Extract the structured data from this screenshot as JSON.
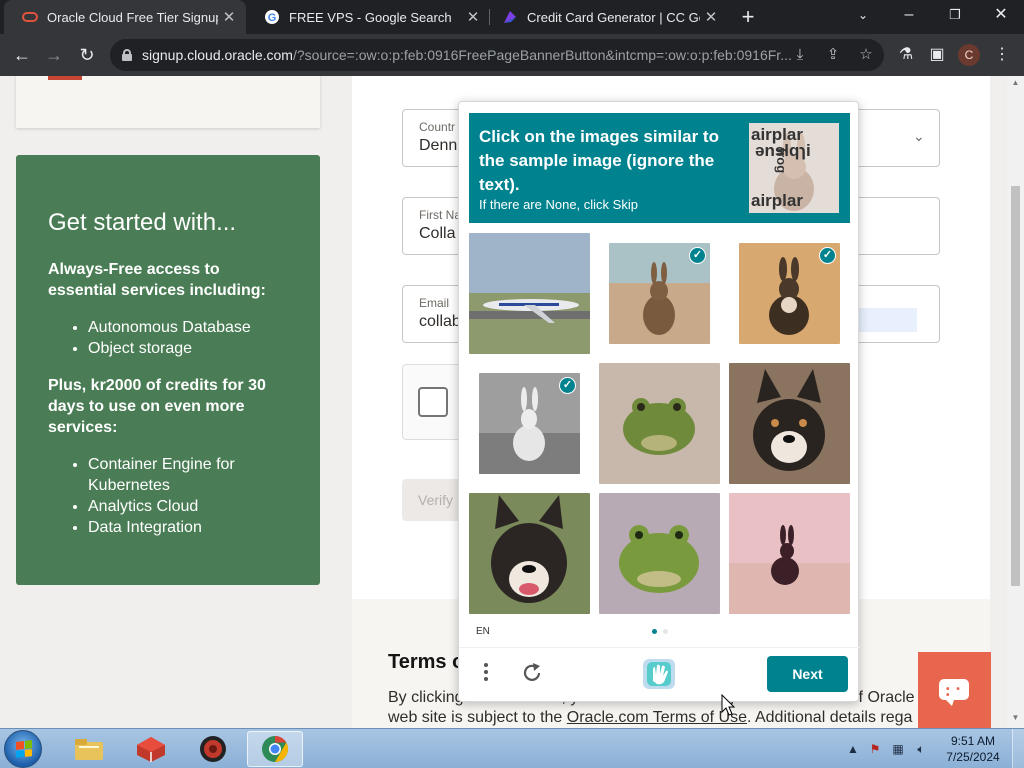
{
  "browser": {
    "tabs": [
      {
        "title": "Oracle Cloud Free Tier Signup",
        "active": true,
        "favicon": "oracle-icon"
      },
      {
        "title": "FREE VPS - Google Search",
        "active": false,
        "favicon": "google-icon"
      },
      {
        "title": "Credit Card Generator | CC Gene",
        "active": false,
        "favicon": "cc-generator-icon"
      }
    ],
    "url_host": "signup.cloud.oracle.com",
    "url_path": "/?source=:ow:o:p:feb:0916FreePageBannerButton&intcmp=:ow:o:p:feb:0916Fr...",
    "profile_initial": "C",
    "colors": {
      "frame": "#202124",
      "toolbar": "#35363a"
    }
  },
  "sidebar": {
    "heading": "Get started with...",
    "intro": "Always-Free access to essential services including:",
    "list1": [
      "Autonomous Database",
      "Object storage"
    ],
    "plus": "Plus, kr2000 of credits for 30 days to use on even more services:",
    "list2": [
      "Container Engine for Kubernetes",
      "Analytics Cloud",
      "Data Integration"
    ],
    "color": "#4a7d55"
  },
  "form": {
    "country_label": "Countr",
    "country_value": "Denn",
    "first_name_label": "First Na",
    "first_name_value": "Colla",
    "email_label": "Email",
    "email_value": "collab",
    "verify_label": "Verify"
  },
  "terms": {
    "title": "Terms o",
    "line1_prefix": "By clicking on the button, you understand and agree that the use of Oracle",
    "line2_prefix": "web site is subject to the ",
    "line2_link": "Oracle.com Terms of Use",
    "line2_suffix": ". Additional details rega"
  },
  "captcha": {
    "instruction": "Click on the images similar to the sample image (ignore the text).",
    "sub": "If there are None, click Skip",
    "sample_words": [
      "airplar",
      "ənslqɿi",
      "frog",
      "airplar"
    ],
    "tiles": [
      {
        "subject": "airplane",
        "selected": false
      },
      {
        "subject": "rabbit",
        "selected": true
      },
      {
        "subject": "rabbit",
        "selected": true
      },
      {
        "subject": "rabbit",
        "selected": true
      },
      {
        "subject": "frog",
        "selected": false
      },
      {
        "subject": "dog",
        "selected": false
      },
      {
        "subject": "dog",
        "selected": false
      },
      {
        "subject": "frog",
        "selected": false
      },
      {
        "subject": "rabbit",
        "selected": false
      }
    ],
    "language": "EN",
    "next_label": "Next",
    "accent": "#00838f"
  },
  "taskbar": {
    "time": "9:51 AM",
    "date": "7/25/2024"
  }
}
